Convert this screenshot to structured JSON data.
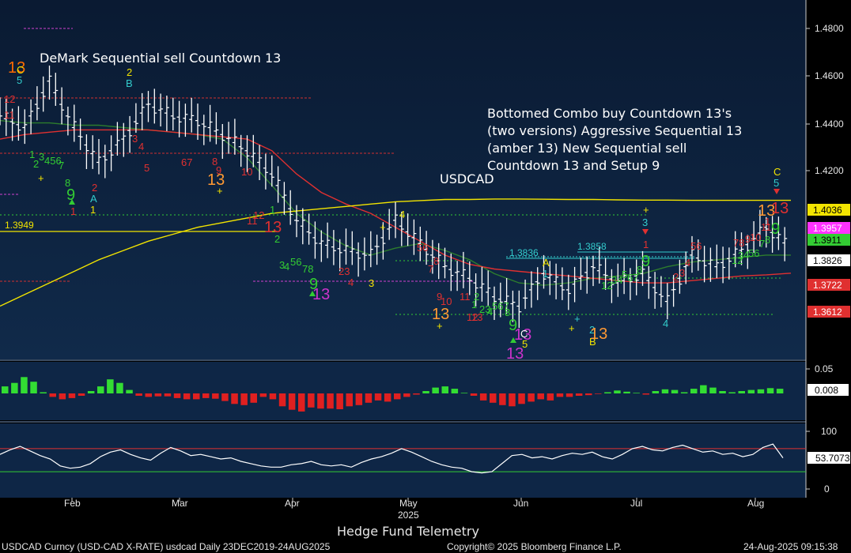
{
  "footer": {
    "left": "USDCAD Curncy (USD-CAD X-RATE) usdcad  Daily 23DEC2019-24AUG2025",
    "center": "Copyright© 2025 Bloomberg Finance L.P.",
    "right": "24-Aug-2025 09:15:38",
    "watermark": "Hedge Fund Telemetry"
  },
  "chart_data": [
    {
      "type": "line",
      "panel": "price",
      "title": "USDCAD",
      "ylim": [
        1.335,
        1.49
      ],
      "y_ticks": [
        "1.4800",
        "1.4600",
        "1.4400",
        "1.4200"
      ],
      "x_month_labels": [
        "Feb",
        "Mar",
        "Apr",
        "May",
        "Jun",
        "Jul",
        "Aug"
      ],
      "x_year_label": "2025",
      "annotations": [
        "DeMark Sequential sell Countdown 13",
        "Bottomed Combo buy Countdown 13's",
        "(two versions) Aggressive Sequential 13",
        "(amber 13) New Sequential sell",
        "Countdown 13 and Setup 9"
      ],
      "level_labels": [
        "1.3949",
        "1.3836",
        "1.3858"
      ],
      "price_tags": [
        {
          "label": "1.4036",
          "color": "#f2e400"
        },
        {
          "label": "1.3957",
          "color": "#ff33ff"
        },
        {
          "label": "1.3911",
          "color": "#33cc33"
        },
        {
          "label": "1.3826",
          "color": "#ffffff"
        },
        {
          "label": "1.3722",
          "color": "#e03030"
        },
        {
          "label": "1.3612",
          "color": "#e03030"
        }
      ],
      "series": [
        {
          "color": "#ffffff",
          "x": [
            "2025-01-13",
            "2025-01-20",
            "2025-01-27",
            "2025-02-03",
            "2025-02-10",
            "2025-02-17",
            "2025-02-24",
            "2025-03-03",
            "2025-03-10",
            "2025-03-17",
            "2025-03-24",
            "2025-03-31",
            "2025-04-07",
            "2025-04-14",
            "2025-04-21",
            "2025-04-28",
            "2025-05-05",
            "2025-05-12",
            "2025-05-19",
            "2025-05-26",
            "2025-06-02",
            "2025-06-09",
            "2025-06-16",
            "2025-06-23",
            "2025-06-30",
            "2025-07-07",
            "2025-07-14",
            "2025-07-21",
            "2025-07-28",
            "2025-08-04",
            "2025-08-11",
            "2025-08-18",
            "2025-08-22"
          ],
          "values": [
            1.44,
            1.435,
            1.455,
            1.435,
            1.42,
            1.43,
            1.445,
            1.44,
            1.438,
            1.432,
            1.425,
            1.415,
            1.395,
            1.385,
            1.382,
            1.38,
            1.395,
            1.385,
            1.375,
            1.37,
            1.362,
            1.358,
            1.372,
            1.365,
            1.375,
            1.368,
            1.372,
            1.36,
            1.38,
            1.375,
            1.382,
            1.392,
            1.383
          ]
        },
        {
          "color": "#f2e400",
          "values": [
            1.358,
            1.363,
            1.368,
            1.373,
            1.378,
            1.382,
            1.386,
            1.389,
            1.392,
            1.394,
            1.396,
            1.398,
            1.399,
            1.4,
            1.401,
            1.402,
            1.403,
            1.4035,
            1.404,
            1.404,
            1.4042,
            1.4042,
            1.4041,
            1.404,
            1.404,
            1.4038,
            1.4037,
            1.4037,
            1.4036,
            1.4036,
            1.4036,
            1.4036,
            1.4036
          ]
        },
        {
          "color": "#e03030",
          "values": [
            1.43,
            1.432,
            1.433,
            1.434,
            1.434,
            1.434,
            1.434,
            1.433,
            1.432,
            1.431,
            1.43,
            1.425,
            1.415,
            1.407,
            1.402,
            1.398,
            1.392,
            1.386,
            1.38,
            1.376,
            1.374,
            1.373,
            1.372,
            1.371,
            1.37,
            1.369,
            1.368,
            1.368,
            1.369,
            1.37,
            1.371,
            1.3715,
            1.3722
          ]
        },
        {
          "color": "#2d7d2d",
          "values": [
            1.438,
            1.437,
            1.437,
            1.436,
            1.436,
            1.435,
            1.434,
            1.433,
            1.432,
            1.43,
            1.422,
            1.41,
            1.398,
            1.39,
            1.384,
            1.38,
            1.383,
            1.385,
            1.382,
            1.378,
            1.372,
            1.368,
            1.367,
            1.368,
            1.37,
            1.371,
            1.372,
            1.375,
            1.377,
            1.378,
            1.379,
            1.38,
            1.38
          ]
        }
      ]
    },
    {
      "type": "bar",
      "panel": "momentum",
      "y_ticks": [
        "0.05"
      ],
      "last_label": "0.008",
      "ylim": [
        -0.045,
        0.055
      ],
      "values": [
        0.012,
        0.018,
        0.028,
        0.02,
        0.002,
        -0.006,
        -0.01,
        -0.008,
        -0.004,
        0.004,
        0.012,
        0.024,
        0.018,
        0.006,
        -0.004,
        -0.006,
        -0.005,
        -0.005,
        -0.008,
        -0.01,
        -0.01,
        -0.008,
        -0.009,
        -0.013,
        -0.018,
        -0.02,
        -0.016,
        -0.006,
        -0.01,
        -0.022,
        -0.028,
        -0.031,
        -0.024,
        -0.026,
        -0.026,
        -0.027,
        -0.022,
        -0.02,
        -0.016,
        -0.012,
        -0.014,
        -0.01,
        -0.006,
        -0.002,
        0.004,
        0.01,
        0.012,
        0.008,
        0.001,
        -0.004,
        -0.012,
        -0.016,
        -0.02,
        -0.022,
        -0.018,
        -0.014,
        -0.01,
        -0.012,
        -0.006,
        -0.006,
        -0.004,
        -0.003,
        -0.001,
        0.002,
        0.005,
        0.003,
        0.001,
        -0.002,
        0.004,
        0.007,
        0.006,
        0.002,
        0.008,
        0.014,
        0.01,
        0.004,
        0.002,
        0.004,
        0.006,
        0.007,
        0.009,
        0.008
      ]
    },
    {
      "type": "line",
      "panel": "oscillator",
      "y_ticks": [
        "100",
        "0"
      ],
      "last_label": "53.7073",
      "upper_line": 70,
      "lower_line": 30,
      "ylim": [
        0,
        100
      ],
      "values": [
        60,
        68,
        74,
        66,
        58,
        52,
        40,
        36,
        38,
        44,
        56,
        64,
        68,
        60,
        54,
        50,
        62,
        72,
        66,
        58,
        60,
        56,
        52,
        54,
        48,
        44,
        40,
        38,
        38,
        42,
        44,
        48,
        42,
        40,
        42,
        38,
        46,
        52,
        56,
        62,
        70,
        64,
        56,
        48,
        42,
        38,
        36,
        30,
        28,
        30,
        44,
        58,
        60,
        54,
        56,
        52,
        58,
        62,
        60,
        64,
        56,
        52,
        60,
        70,
        74,
        68,
        66,
        72,
        76,
        70,
        64,
        66,
        60,
        62,
        56,
        60,
        72,
        78,
        54
      ]
    }
  ]
}
